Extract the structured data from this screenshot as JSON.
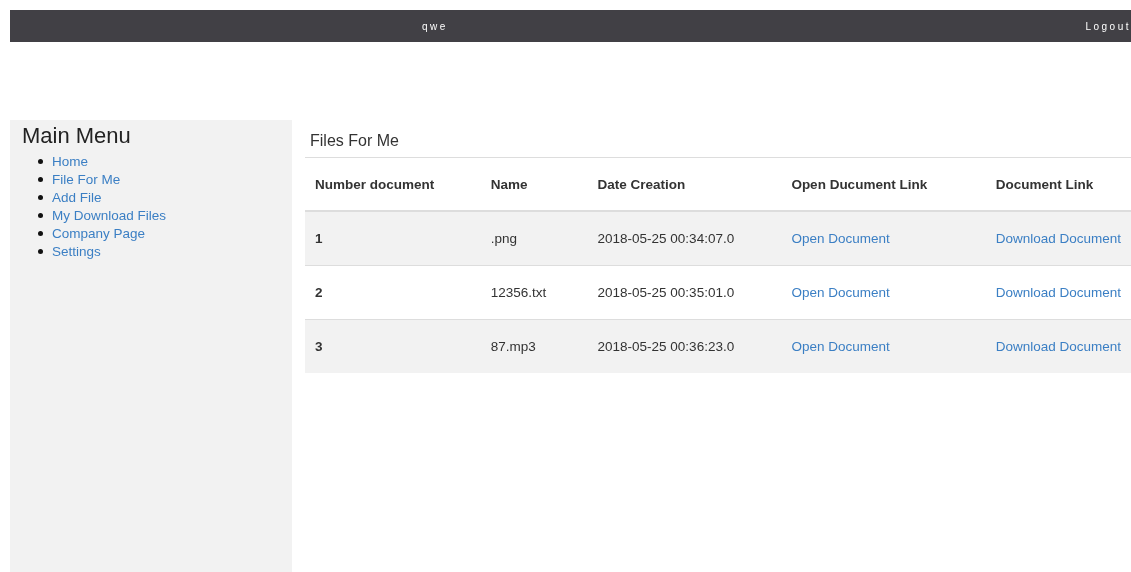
{
  "topbar": {
    "title": "qwe",
    "logout": "Logout"
  },
  "sidebar": {
    "title": "Main Menu",
    "items": [
      {
        "label": "Home"
      },
      {
        "label": "File For Me"
      },
      {
        "label": "Add File"
      },
      {
        "label": "My Download Files"
      },
      {
        "label": "Company Page"
      },
      {
        "label": "Settings"
      }
    ]
  },
  "main": {
    "title": "Files For Me",
    "table": {
      "columns": [
        "Number document",
        "Name",
        "Date Creation",
        "Open Ducument Link",
        "Document Link"
      ],
      "rows": [
        {
          "number": "1",
          "name": ".png",
          "date": "2018-05-25 00:34:07.0",
          "open": "Open Document",
          "download": "Download Document"
        },
        {
          "number": "2",
          "name": "12356.txt",
          "date": "2018-05-25 00:35:01.0",
          "open": "Open Document",
          "download": "Download Document"
        },
        {
          "number": "3",
          "name": "87.mp3",
          "date": "2018-05-25 00:36:23.0",
          "open": "Open Document",
          "download": "Download Document"
        }
      ]
    }
  }
}
